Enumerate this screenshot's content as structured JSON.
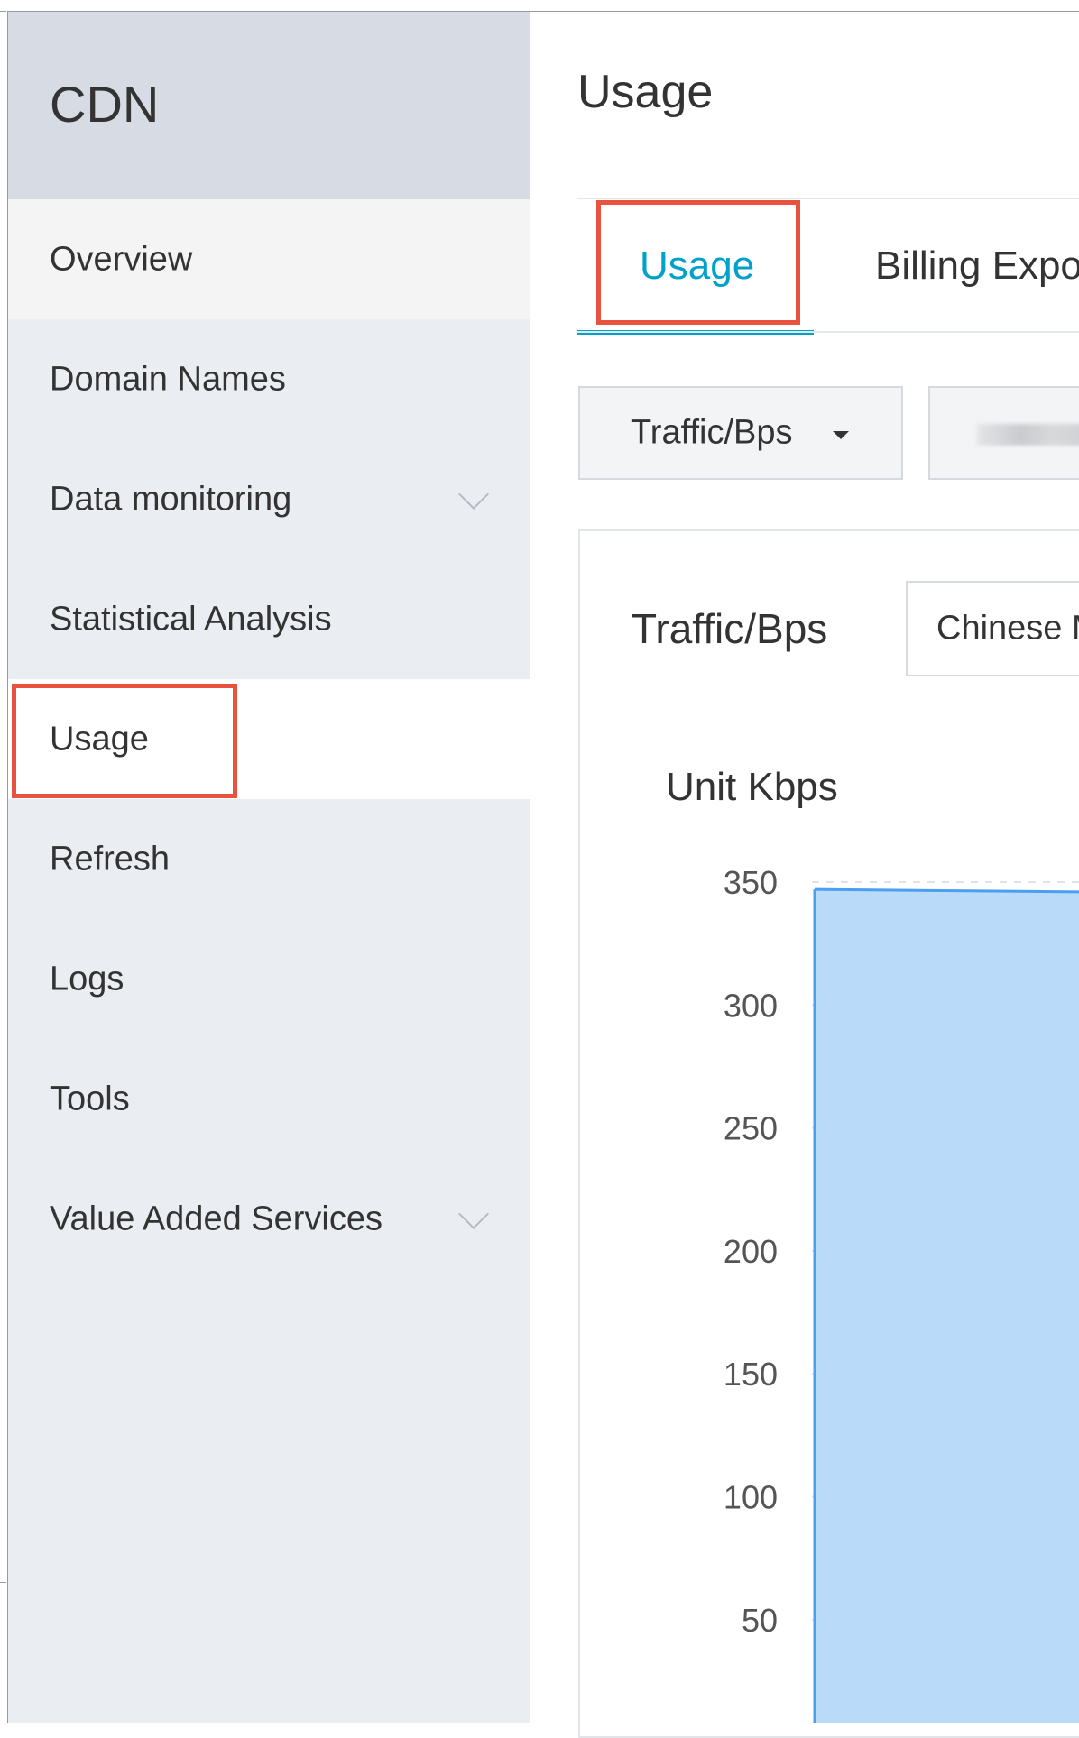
{
  "sidebar": {
    "title": "CDN",
    "items": [
      {
        "label": "Overview"
      },
      {
        "label": "Domain Names"
      },
      {
        "label": "Data monitoring"
      },
      {
        "label": "Statistical Analysis"
      },
      {
        "label": "Usage"
      },
      {
        "label": "Refresh"
      },
      {
        "label": "Logs"
      },
      {
        "label": "Tools"
      },
      {
        "label": "Value Added Services"
      }
    ],
    "active_item": "Usage"
  },
  "main": {
    "title": "Usage",
    "tabs": [
      {
        "label": "Usage"
      },
      {
        "label": "Billing Expo"
      }
    ],
    "active_tab": "Usage",
    "metric_dropdown": {
      "label": "Traffic/Bps"
    },
    "panel": {
      "metric_label": "Traffic/Bps",
      "region_select": "Chinese M",
      "unit_label": "Unit Kbps"
    }
  },
  "colors": {
    "accent": "#00a2ca",
    "highlight_box": "#e8523f",
    "sidebar_bg": "#eaedf1",
    "sidebar_header_bg": "#d7dce4",
    "area_fill": "#b9daf9",
    "area_line": "#4a9ff0"
  },
  "icons": {
    "expand": "chevron-down-icon",
    "dropdown": "caret-down-icon"
  },
  "chart_data": {
    "type": "area",
    "ylabel": "Unit Kbps",
    "yticks": [
      50,
      100,
      150,
      200,
      250,
      300,
      350
    ],
    "ylim": [
      0,
      350
    ],
    "grid": true,
    "series": [
      {
        "values": [
          347,
          346
        ]
      }
    ]
  }
}
